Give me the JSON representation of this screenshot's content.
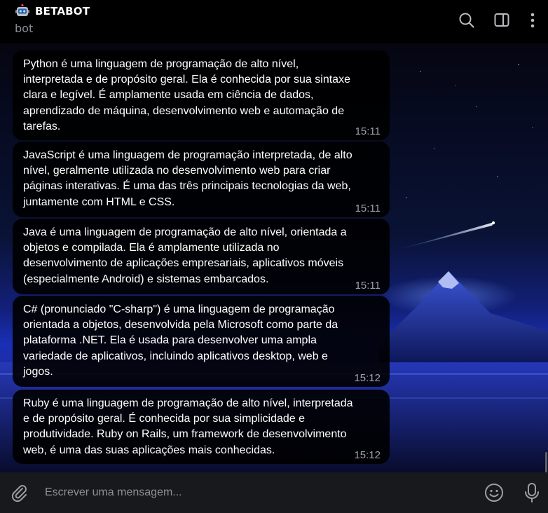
{
  "header": {
    "title": "BETABOT",
    "subtitle": "bot",
    "icons": [
      "robot-icon",
      "search-icon",
      "sidebar-toggle-icon",
      "more-vertical-icon"
    ]
  },
  "messages": [
    {
      "text": "Python é uma linguagem de programação de alto nível,\ninterpretada e de propósito geral. Ela é conhecida por sua sintaxe\nclara e legível. É amplamente usada em ciência de dados,\naprendizado de máquina, desenvolvimento web e automação de\ntarefas.",
      "time": "15:11"
    },
    {
      "text": "JavaScript é uma linguagem de programação interpretada, de alto\nnível, geralmente utilizada no desenvolvimento web para criar\npáginas interativas. É uma das três principais tecnologias da web,\njuntamente com HTML e CSS.",
      "time": "15:11"
    },
    {
      "text": "Java é uma linguagem de programação de alto nível, orientada a\nobjetos e compilada. Ela é amplamente utilizada no\ndesenvolvimento de aplicações empresariais, aplicativos móveis\n(especialmente Android) e sistemas embarcados.",
      "time": "15:11"
    },
    {
      "text": "C# (pronunciado \"C-sharp\") é uma linguagem de programação\norientada a objetos, desenvolvida pela Microsoft como parte da\nplataforma .NET. Ela é usada para desenvolver uma ampla\nvariedade de aplicativos, incluindo aplicativos desktop, web e\njogos.",
      "time": "15:12"
    },
    {
      "text": "Ruby é uma linguagem de programação de alto nível, interpretada\ne de propósito geral. É conhecida por sua simplicidade e\nprodutividade. Ruby on Rails, um framework de desenvolvimento\nweb, é uma das suas aplicações mais conhecidas.",
      "time": "15:12"
    }
  ],
  "composer": {
    "placeholder": "Escrever uma mensagem...",
    "icons": [
      "paperclip-icon",
      "emoji-icon",
      "microphone-icon"
    ]
  },
  "colors": {
    "background": "#000000",
    "bubble": "#000000",
    "text": "#ffffff",
    "time": "#9ea3ab",
    "composer": "#17191d",
    "wallpaper_accent": "#1a2fb5"
  }
}
